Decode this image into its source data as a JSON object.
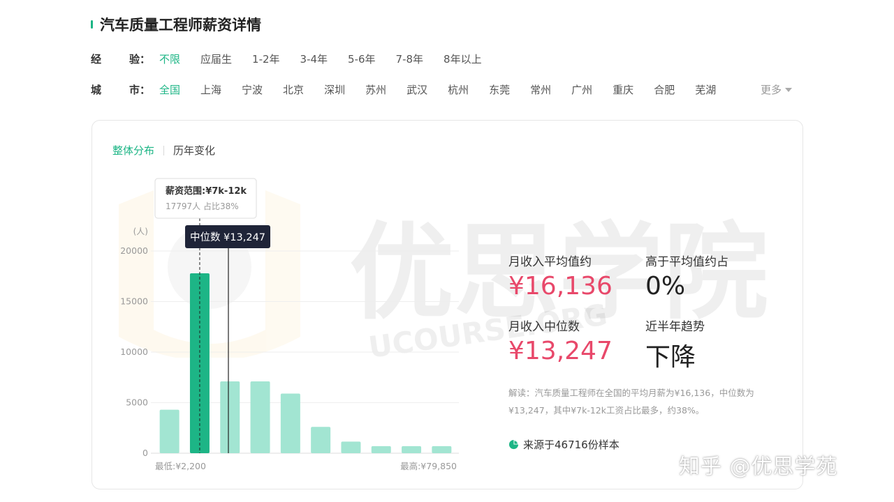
{
  "page": {
    "title": "汽车质量工程师薪资详情"
  },
  "filters": {
    "experience": {
      "label_a": "经",
      "label_b": "验：",
      "options": [
        "不限",
        "应届生",
        "1-2年",
        "3-4年",
        "5-6年",
        "7-8年",
        "8年以上"
      ],
      "selected": "不限"
    },
    "city": {
      "label_a": "城",
      "label_b": "市：",
      "options": [
        "全国",
        "上海",
        "宁波",
        "北京",
        "深圳",
        "苏州",
        "武汉",
        "杭州",
        "东莞",
        "常州",
        "广州",
        "重庆",
        "合肥",
        "芜湖"
      ],
      "selected": "全国",
      "more_label": "更多"
    }
  },
  "tabs": [
    {
      "label": "整体分布",
      "active": true
    },
    {
      "label": "历年变化",
      "active": false
    }
  ],
  "watermark": {
    "main": "优思学院",
    "sub": "UCOURSE.ORG"
  },
  "chart_data": {
    "type": "bar",
    "y_unit": "(人)",
    "yticks": [
      0,
      5000,
      10000,
      15000,
      20000
    ],
    "ylim": [
      0,
      20000
    ],
    "values": [
      4300,
      17797,
      7100,
      7100,
      5900,
      2600,
      1150,
      700,
      700,
      700
    ],
    "highlight_index": 1,
    "min_label": "最低:¥2,200",
    "max_label": "最高:¥79,850",
    "median_label": "中位数 ¥13,247",
    "tooltip": {
      "title": "薪资范围:¥7k-12k",
      "detail": "17797人  占比38%"
    },
    "colors": {
      "bar": "#a2e5d2",
      "highlight": "#1db586",
      "grid": "#eeeeee"
    }
  },
  "stats": {
    "avg_label": "月收入平均值约",
    "avg_value": "¥16,136",
    "above_label": "高于平均值约占",
    "above_value": "0%",
    "median_label": "月收入中位数",
    "median_value": "¥13,247",
    "trend_label": "近半年趋势",
    "trend_value": "下降"
  },
  "explain": "解读：汽车质量工程师在全国的平均月薪为¥16,136，中位数为¥13,247，其中¥7k-12k工资占比最多，约38%。",
  "source": "来源于46716份样本",
  "overlay": "知乎 @优思学苑"
}
